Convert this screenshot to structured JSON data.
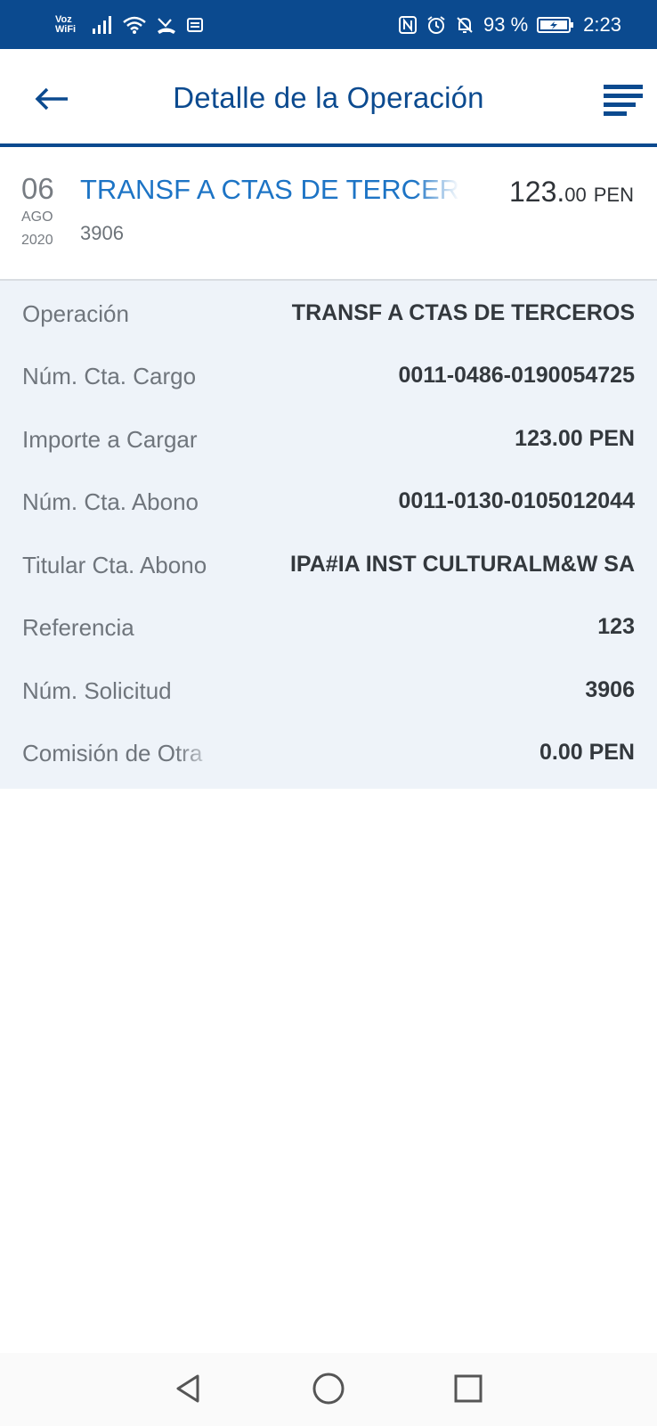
{
  "status_bar": {
    "voz_line1": "Voz",
    "voz_line2": "WiFi",
    "battery_percent": "93 %",
    "time": "2:23",
    "colors": {
      "background": "#0b4a8f"
    }
  },
  "header": {
    "title": "Detalle de la Operación",
    "back_icon": "arrow-left-icon",
    "menu_icon": "hamburger-menu-icon"
  },
  "summary": {
    "day": "06",
    "month": "AGO",
    "year": "2020",
    "title": "TRANSF A CTAS DE TERCEROS",
    "number": "3906",
    "amount_integer": "123.",
    "amount_decimal": "00",
    "currency": "PEN"
  },
  "details": [
    {
      "label": "Operación",
      "value": "TRANSF A CTAS DE TERCEROS"
    },
    {
      "label": "Núm. Cta. Cargo",
      "value": "0011-0486-0190054725"
    },
    {
      "label": "Importe a Cargar",
      "value": "123.00 PEN"
    },
    {
      "label": "Núm. Cta. Abono",
      "value": "0011-0130-0105012044"
    },
    {
      "label": "Titular Cta. Abono",
      "value": "IPA#IA INST CULTURALM&W SA"
    },
    {
      "label": "Referencia",
      "value": "123"
    },
    {
      "label": "Núm. Solicitud",
      "value": "3906"
    },
    {
      "label": "Comisión de Otra",
      "value": "0.00 PEN"
    }
  ],
  "nav_bar": {
    "icons": [
      "back-triangle-icon",
      "home-circle-icon",
      "recents-square-icon"
    ]
  },
  "colors": {
    "brand": "#0b4a8f",
    "link_blue": "#1d74c5",
    "details_background": "#eef3f9"
  }
}
